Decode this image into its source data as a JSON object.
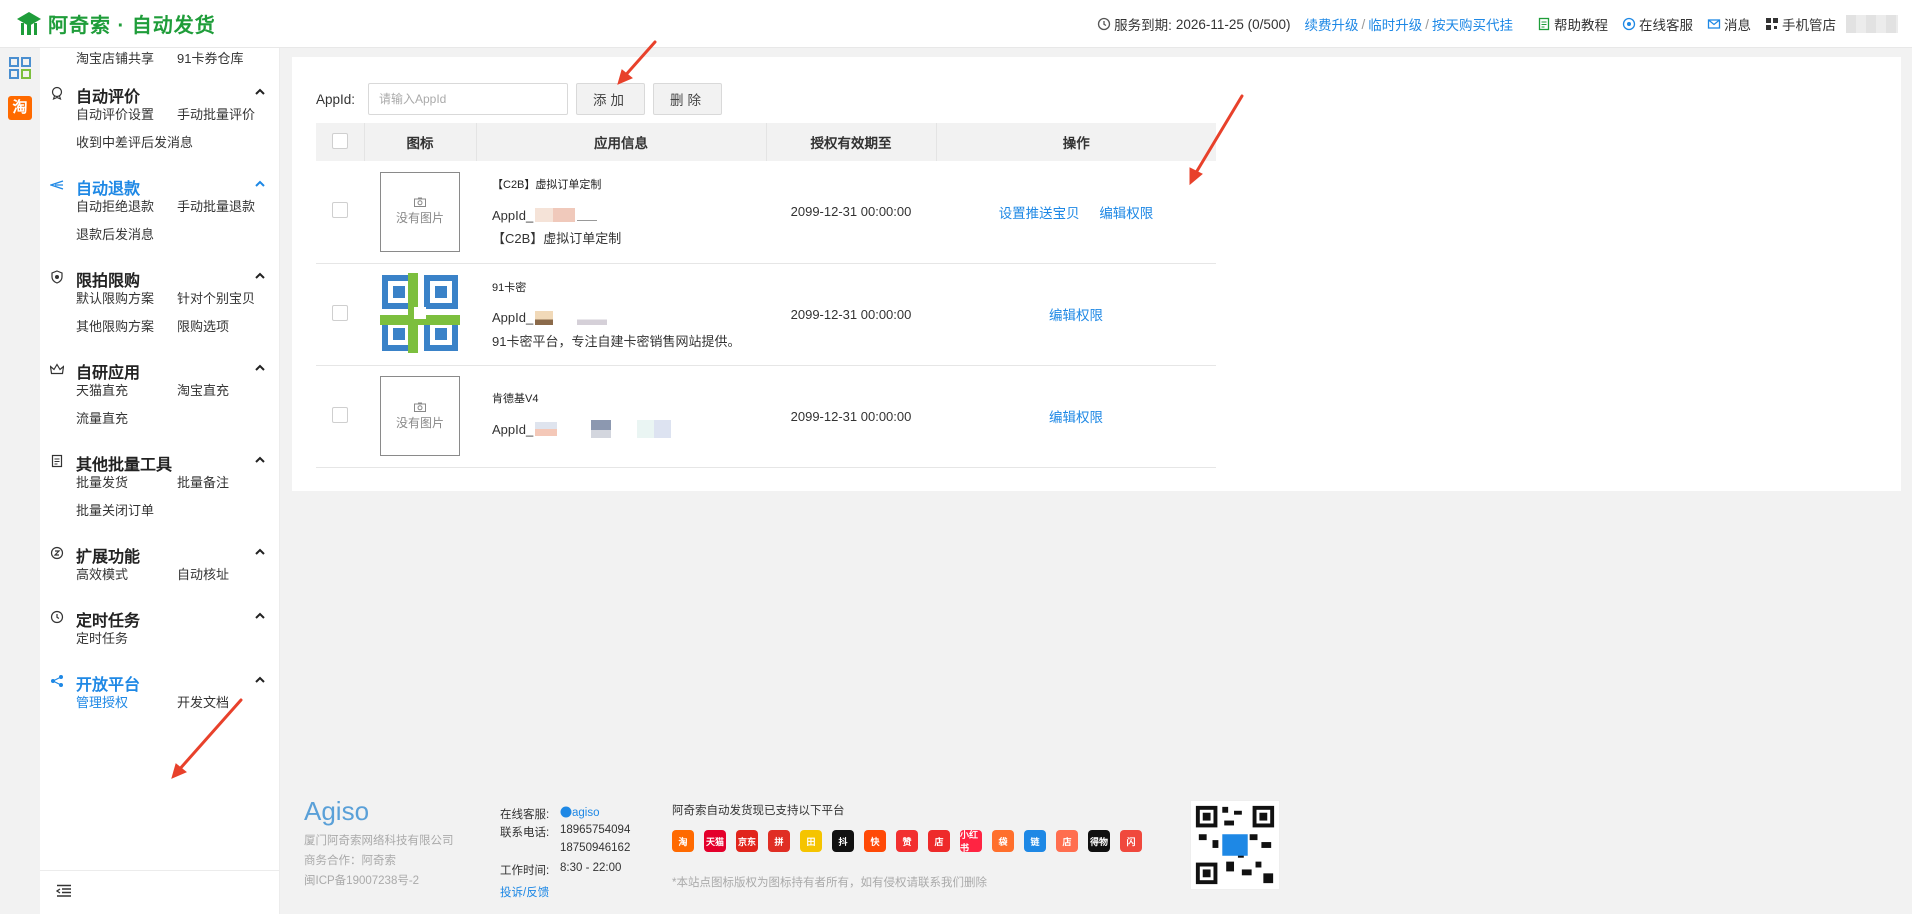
{
  "header": {
    "brand": "阿奇索 · 自动发货",
    "service_label": "服务到期:",
    "service_value": "2026-11-25 (0/500)",
    "links": [
      "续费升级",
      "临时升级",
      "按天购买代挂"
    ],
    "help": "帮助教程",
    "online": "在线客服",
    "messages": "消息",
    "mobile": "手机管店"
  },
  "sidebar": {
    "top_items": [
      "淘宝店铺共享",
      "91卡券仓库"
    ],
    "groups": [
      {
        "title": "自动评价",
        "icon": "badge-icon",
        "items": [
          "自动评价设置",
          "手动批量评价",
          "收到中差评后发消息"
        ]
      },
      {
        "title": "自动退款",
        "icon": "refund-icon",
        "items": [
          "自动拒绝退款",
          "手动批量退款",
          "退款后发消息"
        ]
      },
      {
        "title": "限拍限购",
        "icon": "shield-icon",
        "items": [
          "默认限购方案",
          "针对个别宝贝",
          "其他限购方案",
          "限购选项"
        ]
      },
      {
        "title": "自研应用",
        "icon": "crown-icon",
        "items": [
          "天猫直充",
          "淘宝直充",
          "流量直充"
        ]
      },
      {
        "title": "其他批量工具",
        "icon": "doc-icon",
        "items": [
          "批量发货",
          "批量备注",
          "批量关闭订单"
        ]
      },
      {
        "title": "扩展功能",
        "icon": "extend-icon",
        "items": [
          "高效模式",
          "自动核址"
        ]
      },
      {
        "title": "定时任务",
        "icon": "clock-icon",
        "items": [
          "定时任务"
        ]
      },
      {
        "title": "开放平台",
        "icon": "share-icon",
        "items": [
          "管理授权",
          "开发文档"
        ]
      }
    ]
  },
  "toolbar": {
    "label": "AppId:",
    "placeholder": "请输入AppId",
    "add": "添加",
    "delete": "删除"
  },
  "table": {
    "headers": [
      "图标",
      "应用信息",
      "授权有效期至",
      "操作"
    ],
    "no_image": "没有图片",
    "rows": [
      {
        "name": "【C2B】虚拟订单定制",
        "appid_prefix": "AppId_",
        "desc": "【C2B】虚拟订单定制",
        "expiry": "2099-12-31 00:00:00",
        "ops": [
          "设置推送宝贝",
          "编辑权限"
        ]
      },
      {
        "name": "91卡密",
        "appid_prefix": "AppId_",
        "desc": "91卡密平台，专注自建卡密销售网站提供。",
        "expiry": "2099-12-31 00:00:00",
        "ops": [
          "编辑权限"
        ]
      },
      {
        "name": "肯德基V4",
        "appid_prefix": "AppId_",
        "desc": "",
        "expiry": "2099-12-31 00:00:00",
        "ops": [
          "编辑权限"
        ]
      }
    ]
  },
  "footer": {
    "logo": "Agiso",
    "company": "厦门阿奇索网络科技有限公司",
    "partner": "商务合作：阿奇索",
    "icp": "闽ICP备19007238号-2",
    "online_label": "在线客服:",
    "online_value": "agiso",
    "phone_label": "联系电话:",
    "phone1": "18965754094",
    "phone2": "18750946162",
    "hours_label": "工作时间:",
    "hours_value": "8:30 - 22:00",
    "complaint": "投诉/反馈",
    "platforms_title": "阿奇索自动发货现已支持以下平台",
    "platforms": [
      {
        "label": "淘",
        "color": "#ff6a00"
      },
      {
        "label": "天猫",
        "color": "#e4002b"
      },
      {
        "label": "京东",
        "color": "#e1251b"
      },
      {
        "label": "拼",
        "color": "#e02e24"
      },
      {
        "label": "田",
        "color": "#f5c400"
      },
      {
        "label": "抖",
        "color": "#111111"
      },
      {
        "label": "快",
        "color": "#ff4906"
      },
      {
        "label": "赞",
        "color": "#f23030"
      },
      {
        "label": "店",
        "color": "#ee2a2a"
      },
      {
        "label": "小红书",
        "color": "#ff2442"
      },
      {
        "label": "袋",
        "color": "#ff6f2c"
      },
      {
        "label": "链",
        "color": "#1e88e5"
      },
      {
        "label": "店",
        "color": "#ff6e4f"
      },
      {
        "label": "得物",
        "color": "#111111"
      },
      {
        "label": "闪",
        "color": "#f0493d"
      }
    ],
    "disclaimer": "*本站点图标版权为图标持有者所有，如有侵权请联系我们删除"
  },
  "colors": {
    "brand": "#1f9d3a",
    "link": "#1e88e5",
    "arrow": "#e8412b"
  }
}
